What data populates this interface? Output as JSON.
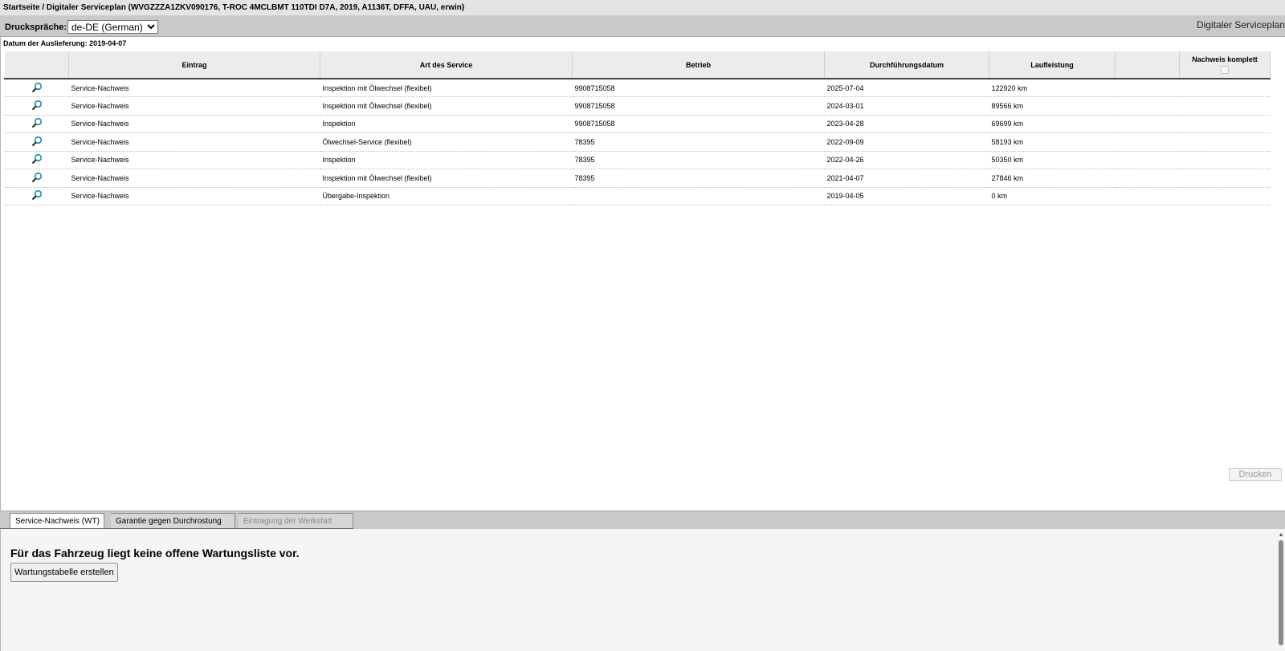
{
  "breadcrumb": "Startseite / Digitaler Serviceplan (WVGZZZA1ZKV090176, T-ROC 4MCLBMT 110TDI D7A, 2019, A1136T, DFFA, UAU, erwin)",
  "toolbar": {
    "print_language_label": "Druckspräche:",
    "print_language_value": "de-DE (German)",
    "app_title": "Digitaler Serviceplan"
  },
  "delivery_date": "Datum der Auslieferung: 2019-04-07",
  "table": {
    "headers": {
      "entry": "Eintrag",
      "service_type": "Art des Service",
      "workshop": "Betrieb",
      "date": "Durchführungsdatum",
      "mileage": "Laufleistung",
      "proof_complete": "Nachweis komplett"
    },
    "rows": [
      {
        "entry": "Service-Nachweis",
        "service_type": "Inspektion mit Ölwechsel (flexibel)",
        "workshop": "9908715058",
        "date": "2025-07-04",
        "mileage": "122920 km"
      },
      {
        "entry": "Service-Nachweis",
        "service_type": "Inspektion mit Ölwechsel (flexibel)",
        "workshop": "9908715058",
        "date": "2024-03-01",
        "mileage": "89566 km"
      },
      {
        "entry": "Service-Nachweis",
        "service_type": "Inspektion",
        "workshop": "9908715058",
        "date": "2023-04-28",
        "mileage": "69699 km"
      },
      {
        "entry": "Service-Nachweis",
        "service_type": "Ölwechsel-Service (flexibel)",
        "workshop": "78395",
        "date": "2022-09-09",
        "mileage": "58193 km"
      },
      {
        "entry": "Service-Nachweis",
        "service_type": "Inspektion",
        "workshop": "78395",
        "date": "2022-04-26",
        "mileage": "50350 km"
      },
      {
        "entry": "Service-Nachweis",
        "service_type": "Inspektion mit Ölwechsel (flexibel)",
        "workshop": "78395",
        "date": "2021-04-07",
        "mileage": "27846 km"
      },
      {
        "entry": "Service-Nachweis",
        "service_type": "Übergabe-Inspektion",
        "workshop": "",
        "date": "2019-04-05",
        "mileage": "0 km"
      }
    ]
  },
  "print_button": "Drucken",
  "tabs": [
    {
      "label": "Service-Nachweis (WT)"
    },
    {
      "label": "Garantie gegen Durchrostung"
    },
    {
      "label": "Eintragung der Werkstatt"
    }
  ],
  "panel": {
    "message": "Für das Fahrzeug liegt keine offene Wartungsliste vor.",
    "create_button": "Wartungstabelle erstellen"
  },
  "colors": {
    "header_bar": "#c9c9c9",
    "table_header": "#ececec",
    "magnifier": "#1a8aa0"
  }
}
